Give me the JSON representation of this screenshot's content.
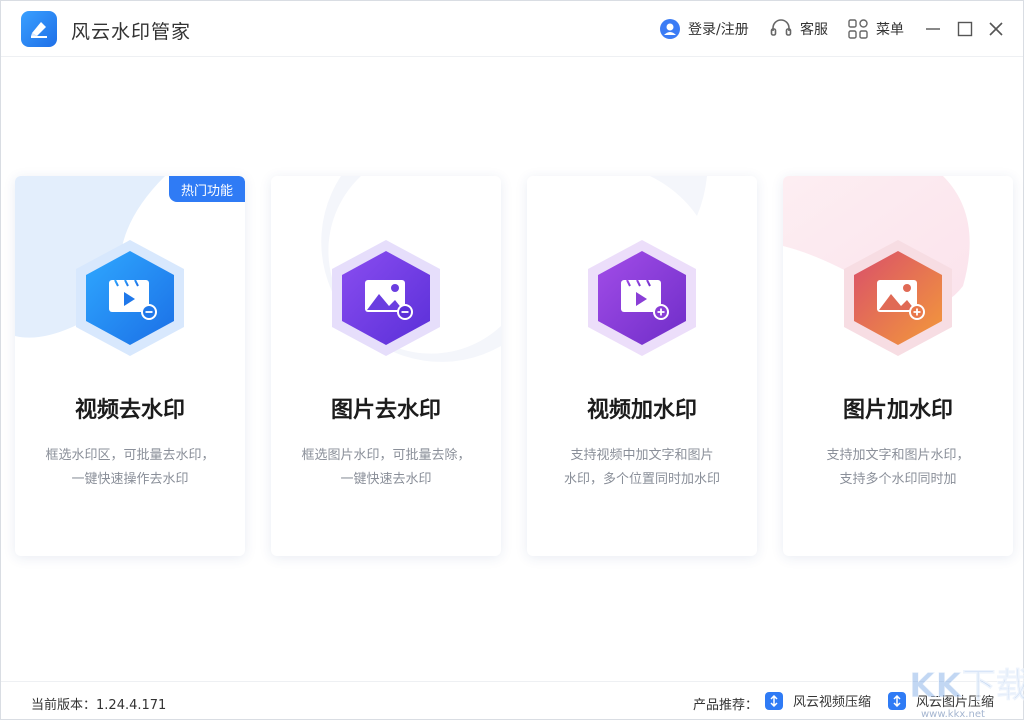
{
  "app": {
    "title": "风云水印管家"
  },
  "header": {
    "login_label": "登录/注册",
    "service_label": "客服",
    "menu_label": "菜单"
  },
  "cards": [
    {
      "title": "视频去水印",
      "desc_line1": "框选水印区，可批量去水印，",
      "desc_line2": "一键快速操作去水印",
      "badge": "热门功能",
      "icon": "video-remove-icon"
    },
    {
      "title": "图片去水印",
      "desc_line1": "框选图片水印，可批量去除，",
      "desc_line2": "一键快速去水印",
      "icon": "image-remove-icon"
    },
    {
      "title": "视频加水印",
      "desc_line1": "支持视频中加文字和图片",
      "desc_line2": "水印，多个位置同时加水印",
      "icon": "video-add-icon"
    },
    {
      "title": "图片加水印",
      "desc_line1": "支持加文字和图片水印，",
      "desc_line2": "支持多个水印同时加",
      "icon": "image-add-icon"
    }
  ],
  "footer": {
    "version_label": "当前版本：",
    "version": "1.24.4.171",
    "recommend_label": "产品推荐：",
    "products": [
      "风云视频压缩",
      "风云图片压缩"
    ]
  },
  "watermark": {
    "text": "KK下载",
    "url": "www.kkx.net"
  },
  "colors": {
    "accent": "#2f7bf5",
    "card1": "#2a8cf0",
    "card2": "#6a3ee0",
    "card3": "#8a3ed6",
    "card4": "#e85a5a"
  }
}
